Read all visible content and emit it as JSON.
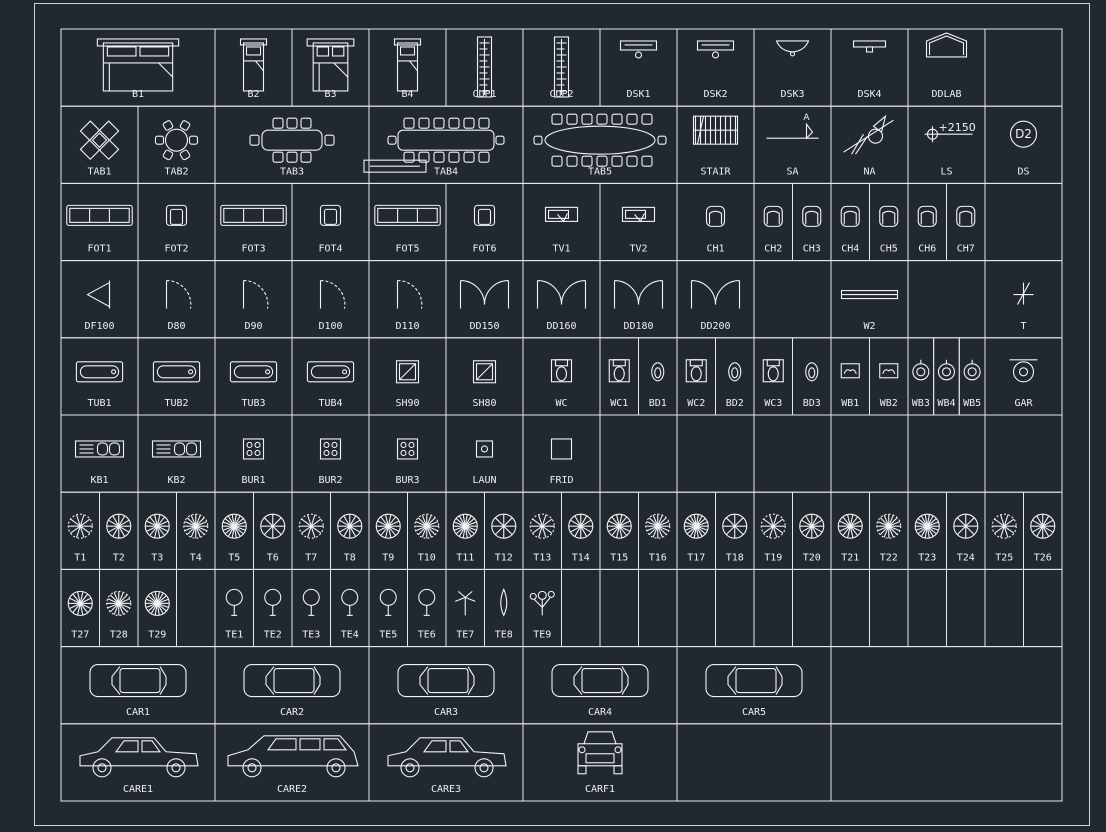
{
  "drawing": {
    "rows": [
      {
        "y": 0,
        "h": 1,
        "cells": [
          {
            "label": "B1",
            "icon": "bed-double-icon",
            "c": 0,
            "w": 2
          },
          {
            "label": "B2",
            "icon": "bed-single-icon",
            "c": 2,
            "w": 1
          },
          {
            "label": "B3",
            "icon": "bed-double-icon",
            "c": 3,
            "w": 1
          },
          {
            "label": "B4",
            "icon": "bed-single-icon",
            "c": 4,
            "w": 1
          },
          {
            "label": "CUP1",
            "icon": "cupboard-icon",
            "c": 5,
            "w": 1
          },
          {
            "label": "CUP2",
            "icon": "cupboard-icon",
            "c": 6,
            "w": 1
          },
          {
            "label": "DSK1",
            "icon": "desk-icon",
            "c": 7,
            "w": 1
          },
          {
            "label": "DSK2",
            "icon": "desk-icon",
            "c": 8,
            "w": 1
          },
          {
            "label": "DSK3",
            "icon": "desk-round-icon",
            "c": 9,
            "w": 1
          },
          {
            "label": "DSK4",
            "icon": "desk-small-icon",
            "c": 10,
            "w": 1
          },
          {
            "label": "DDLAB",
            "icon": "house-icon",
            "c": 11,
            "w": 1
          },
          {
            "label": "",
            "icon": "",
            "c": 12,
            "w": 1
          }
        ]
      },
      {
        "y": 1,
        "h": 1,
        "cells": [
          {
            "label": "TAB1",
            "icon": "table-diagonal-icon",
            "c": 0,
            "w": 1
          },
          {
            "label": "TAB2",
            "icon": "table-round-icon",
            "c": 1,
            "w": 1
          },
          {
            "label": "TAB3",
            "icon": "table-6-icon",
            "c": 2,
            "w": 2
          },
          {
            "label": "TAB4",
            "icon": "table-12-icon",
            "c": 4,
            "w": 2
          },
          {
            "label": "TAB5",
            "icon": "table-oval-icon",
            "c": 6,
            "w": 2
          },
          {
            "label": "STAIR",
            "icon": "stair-icon",
            "c": 8,
            "w": 1
          },
          {
            "label": "SA",
            "icon": "section-arrow-icon",
            "c": 9,
            "w": 1
          },
          {
            "label": "NA",
            "icon": "north-arrow-icon",
            "c": 10,
            "w": 1
          },
          {
            "label": "LS",
            "icon": "level-symbol-icon",
            "c": 11,
            "w": 1
          },
          {
            "label": "DS",
            "icon": "door-symbol-icon",
            "c": 12,
            "w": 1
          }
        ]
      },
      {
        "y": 2,
        "h": 1,
        "cells": [
          {
            "label": "FOT1",
            "icon": "sofa-icon",
            "c": 0,
            "w": 1
          },
          {
            "label": "FOT2",
            "icon": "armchair-icon",
            "c": 1,
            "w": 1
          },
          {
            "label": "FOT3",
            "icon": "sofa-icon",
            "c": 2,
            "w": 1
          },
          {
            "label": "FOT4",
            "icon": "armchair-icon",
            "c": 3,
            "w": 1
          },
          {
            "label": "FOT5",
            "icon": "sofa-icon",
            "c": 4,
            "w": 1
          },
          {
            "label": "FOT6",
            "icon": "armchair-icon",
            "c": 5,
            "w": 1
          },
          {
            "label": "TV1",
            "icon": "tv-icon",
            "c": 6,
            "w": 1
          },
          {
            "label": "TV2",
            "icon": "tv-icon",
            "c": 7,
            "w": 1
          },
          {
            "label": "CH1",
            "icon": "chair-icon",
            "c": 8,
            "w": 1
          },
          {
            "label": "CH2",
            "icon": "chair-icon",
            "c": 9,
            "w": 0.5
          },
          {
            "label": "CH3",
            "icon": "chair-icon",
            "c": 9.5,
            "w": 0.5
          },
          {
            "label": "CH4",
            "icon": "chair-icon",
            "c": 10,
            "w": 0.5
          },
          {
            "label": "CH5",
            "icon": "chair-icon",
            "c": 10.5,
            "w": 0.5
          },
          {
            "label": "CH6",
            "icon": "chair-icon",
            "c": 11,
            "w": 0.5
          },
          {
            "label": "CH7",
            "icon": "chair-icon",
            "c": 11.5,
            "w": 0.5
          },
          {
            "label": "",
            "icon": "",
            "c": 12,
            "w": 1
          }
        ]
      },
      {
        "y": 3,
        "h": 1,
        "cells": [
          {
            "label": "DF100",
            "icon": "door-fold-icon",
            "c": 0,
            "w": 1
          },
          {
            "label": "D80",
            "icon": "door-swing-icon",
            "c": 1,
            "w": 1
          },
          {
            "label": "D90",
            "icon": "door-swing-icon",
            "c": 2,
            "w": 1
          },
          {
            "label": "D100",
            "icon": "door-swing-icon",
            "c": 3,
            "w": 1
          },
          {
            "label": "D110",
            "icon": "door-swing-icon",
            "c": 4,
            "w": 1
          },
          {
            "label": "DD150",
            "icon": "door-double-icon",
            "c": 5,
            "w": 1
          },
          {
            "label": "DD160",
            "icon": "door-double-icon",
            "c": 6,
            "w": 1
          },
          {
            "label": "DD180",
            "icon": "door-double-icon",
            "c": 7,
            "w": 1
          },
          {
            "label": "DD200",
            "icon": "door-double-icon",
            "c": 8,
            "w": 1
          },
          {
            "label": "",
            "icon": "",
            "c": 9,
            "w": 1
          },
          {
            "label": "W2",
            "icon": "window-icon",
            "c": 10,
            "w": 1
          },
          {
            "label": "",
            "icon": "",
            "c": 11,
            "w": 1
          },
          {
            "label": "T",
            "icon": "tag-t-icon",
            "c": 12,
            "w": 1
          }
        ]
      },
      {
        "y": 4,
        "h": 1,
        "cells": [
          {
            "label": "TUB1",
            "icon": "bathtub-icon",
            "c": 0,
            "w": 1
          },
          {
            "label": "TUB2",
            "icon": "bathtub-icon",
            "c": 1,
            "w": 1
          },
          {
            "label": "TUB3",
            "icon": "bathtub-icon",
            "c": 2,
            "w": 1
          },
          {
            "label": "TUB4",
            "icon": "bathtub-icon",
            "c": 3,
            "w": 1
          },
          {
            "label": "SH90",
            "icon": "shower-icon",
            "c": 4,
            "w": 1
          },
          {
            "label": "SH80",
            "icon": "shower-icon",
            "c": 5,
            "w": 1
          },
          {
            "label": "WC",
            "icon": "wc-icon",
            "c": 6,
            "w": 1
          },
          {
            "label": "WC1",
            "icon": "wc-icon",
            "c": 7,
            "w": 0.5
          },
          {
            "label": "BD1",
            "icon": "bidet-icon",
            "c": 7.5,
            "w": 0.5
          },
          {
            "label": "WC2",
            "icon": "wc-icon",
            "c": 8,
            "w": 0.5
          },
          {
            "label": "BD2",
            "icon": "bidet-icon",
            "c": 8.5,
            "w": 0.5
          },
          {
            "label": "WC3",
            "icon": "wc-icon",
            "c": 9,
            "w": 0.5
          },
          {
            "label": "BD3",
            "icon": "bidet-icon",
            "c": 9.5,
            "w": 0.5
          },
          {
            "label": "WB1",
            "icon": "washbasin-icon",
            "c": 10,
            "w": 0.5
          },
          {
            "label": "WB2",
            "icon": "washbasin-icon",
            "c": 10.5,
            "w": 0.5
          },
          {
            "label": "WB3",
            "icon": "washbasin-round-icon",
            "c": 11,
            "w": 0.333
          },
          {
            "label": "WB4",
            "icon": "washbasin-round-icon",
            "c": 11.333,
            "w": 0.333
          },
          {
            "label": "WB5",
            "icon": "washbasin-round-icon",
            "c": 11.666,
            "w": 0.334
          },
          {
            "label": "GAR",
            "icon": "urinal-icon",
            "c": 12,
            "w": 1
          }
        ]
      },
      {
        "y": 5,
        "h": 1,
        "cells": [
          {
            "label": "KB1",
            "icon": "kitchen-sink-icon",
            "c": 0,
            "w": 1
          },
          {
            "label": "KB2",
            "icon": "kitchen-sink-icon",
            "c": 1,
            "w": 1
          },
          {
            "label": "BUR1",
            "icon": "stove-icon",
            "c": 2,
            "w": 1
          },
          {
            "label": "BUR2",
            "icon": "stove-icon",
            "c": 3,
            "w": 1
          },
          {
            "label": "BUR3",
            "icon": "stove-icon",
            "c": 4,
            "w": 1
          },
          {
            "label": "LAUN",
            "icon": "laundry-icon",
            "c": 5,
            "w": 1
          },
          {
            "label": "FRID",
            "icon": "fridge-icon",
            "c": 6,
            "w": 1
          },
          {
            "label": "",
            "icon": "",
            "c": 7,
            "w": 1
          },
          {
            "label": "",
            "icon": "",
            "c": 8,
            "w": 1
          },
          {
            "label": "",
            "icon": "",
            "c": 9,
            "w": 1
          },
          {
            "label": "",
            "icon": "",
            "c": 10,
            "w": 1
          },
          {
            "label": "",
            "icon": "",
            "c": 11,
            "w": 1
          },
          {
            "label": "",
            "icon": "",
            "c": 12,
            "w": 1
          }
        ]
      },
      {
        "y": 6,
        "h": 1,
        "cells": [
          {
            "label": "T1",
            "icon": "tree-plan-icon",
            "c": 0,
            "w": 0.5
          },
          {
            "label": "T2",
            "icon": "tree-plan-icon",
            "c": 0.5,
            "w": 0.5
          },
          {
            "label": "T3",
            "icon": "tree-plan-icon",
            "c": 1,
            "w": 0.5
          },
          {
            "label": "T4",
            "icon": "tree-plan-icon",
            "c": 1.5,
            "w": 0.5
          },
          {
            "label": "T5",
            "icon": "tree-plan-icon",
            "c": 2,
            "w": 0.5
          },
          {
            "label": "T6",
            "icon": "tree-plan-icon",
            "c": 2.5,
            "w": 0.5
          },
          {
            "label": "T7",
            "icon": "tree-plan-icon",
            "c": 3,
            "w": 0.5
          },
          {
            "label": "T8",
            "icon": "tree-plan-icon",
            "c": 3.5,
            "w": 0.5
          },
          {
            "label": "T9",
            "icon": "tree-plan-icon",
            "c": 4,
            "w": 0.5
          },
          {
            "label": "T10",
            "icon": "tree-plan-icon",
            "c": 4.5,
            "w": 0.5
          },
          {
            "label": "T11",
            "icon": "tree-plan-icon",
            "c": 5,
            "w": 0.5
          },
          {
            "label": "T12",
            "icon": "tree-plan-icon",
            "c": 5.5,
            "w": 0.5
          },
          {
            "label": "T13",
            "icon": "tree-plan-icon",
            "c": 6,
            "w": 0.5
          },
          {
            "label": "T14",
            "icon": "tree-plan-icon",
            "c": 6.5,
            "w": 0.5
          },
          {
            "label": "T15",
            "icon": "tree-plan-icon",
            "c": 7,
            "w": 0.5
          },
          {
            "label": "T16",
            "icon": "tree-plan-icon",
            "c": 7.5,
            "w": 0.5
          },
          {
            "label": "T17",
            "icon": "tree-plan-icon",
            "c": 8,
            "w": 0.5
          },
          {
            "label": "T18",
            "icon": "tree-plan-icon",
            "c": 8.5,
            "w": 0.5
          },
          {
            "label": "T19",
            "icon": "tree-plan-icon",
            "c": 9,
            "w": 0.5
          },
          {
            "label": "T20",
            "icon": "tree-plan-icon",
            "c": 9.5,
            "w": 0.5
          },
          {
            "label": "T21",
            "icon": "tree-plan-icon",
            "c": 10,
            "w": 0.5
          },
          {
            "label": "T22",
            "icon": "tree-plan-icon",
            "c": 10.5,
            "w": 0.5
          },
          {
            "label": "T23",
            "icon": "tree-plan-icon",
            "c": 11,
            "w": 0.5
          },
          {
            "label": "T24",
            "icon": "tree-plan-icon",
            "c": 11.5,
            "w": 0.5
          },
          {
            "label": "T25",
            "icon": "tree-plan-icon",
            "c": 12,
            "w": 0.5
          },
          {
            "label": "T26",
            "icon": "tree-plan-icon",
            "c": 12.5,
            "w": 0.5
          }
        ]
      },
      {
        "y": 7,
        "h": 1,
        "cells": [
          {
            "label": "T27",
            "icon": "tree-plan-icon",
            "c": 0,
            "w": 0.5
          },
          {
            "label": "T28",
            "icon": "tree-plan-icon",
            "c": 0.5,
            "w": 0.5
          },
          {
            "label": "T29",
            "icon": "tree-plan-icon",
            "c": 1,
            "w": 0.5
          },
          {
            "label": "",
            "icon": "",
            "c": 1.5,
            "w": 0.5
          },
          {
            "label": "TE1",
            "icon": "tree-elevation-icon",
            "c": 2,
            "w": 0.5
          },
          {
            "label": "TE2",
            "icon": "tree-elevation-icon",
            "c": 2.5,
            "w": 0.5
          },
          {
            "label": "TE3",
            "icon": "tree-elevation-icon",
            "c": 3,
            "w": 0.5
          },
          {
            "label": "TE4",
            "icon": "tree-elevation-icon",
            "c": 3.5,
            "w": 0.5
          },
          {
            "label": "TE5",
            "icon": "tree-elevation-icon",
            "c": 4,
            "w": 0.5
          },
          {
            "label": "TE6",
            "icon": "tree-elevation-icon",
            "c": 4.5,
            "w": 0.5
          },
          {
            "label": "TE7",
            "icon": "palm-elevation-icon",
            "c": 5,
            "w": 0.5
          },
          {
            "label": "TE8",
            "icon": "cypress-elevation-icon",
            "c": 5.5,
            "w": 0.5
          },
          {
            "label": "TE9",
            "icon": "flower-elevation-icon",
            "c": 6,
            "w": 0.5
          },
          {
            "label": "",
            "icon": "",
            "c": 6.5,
            "w": 0.5
          },
          {
            "label": "",
            "icon": "",
            "c": 7,
            "w": 0.5
          },
          {
            "label": "",
            "icon": "",
            "c": 7.5,
            "w": 0.5
          },
          {
            "label": "",
            "icon": "",
            "c": 8,
            "w": 0.5
          },
          {
            "label": "",
            "icon": "",
            "c": 8.5,
            "w": 0.5
          },
          {
            "label": "",
            "icon": "",
            "c": 9,
            "w": 0.5
          },
          {
            "label": "",
            "icon": "",
            "c": 9.5,
            "w": 0.5
          },
          {
            "label": "",
            "icon": "",
            "c": 10,
            "w": 0.5
          },
          {
            "label": "",
            "icon": "",
            "c": 10.5,
            "w": 0.5
          },
          {
            "label": "",
            "icon": "",
            "c": 11,
            "w": 0.5
          },
          {
            "label": "",
            "icon": "",
            "c": 11.5,
            "w": 0.5
          },
          {
            "label": "",
            "icon": "",
            "c": 12,
            "w": 0.5
          },
          {
            "label": "",
            "icon": "",
            "c": 12.5,
            "w": 0.5
          }
        ]
      },
      {
        "y": 8,
        "h": 1,
        "cells": [
          {
            "label": "CAR1",
            "icon": "car-plan-icon",
            "c": 0,
            "w": 2
          },
          {
            "label": "CAR2",
            "icon": "car-plan-icon",
            "c": 2,
            "w": 2
          },
          {
            "label": "CAR3",
            "icon": "car-plan-icon",
            "c": 4,
            "w": 2
          },
          {
            "label": "CAR4",
            "icon": "car-plan-icon",
            "c": 6,
            "w": 2
          },
          {
            "label": "CAR5",
            "icon": "car-plan-icon",
            "c": 8,
            "w": 2
          },
          {
            "label": "",
            "icon": "",
            "c": 10,
            "w": 3
          }
        ]
      },
      {
        "y": 9,
        "h": 1,
        "cells": [
          {
            "label": "CARE1",
            "icon": "car-side-icon",
            "c": 0,
            "w": 2
          },
          {
            "label": "CARE2",
            "icon": "car-wagon-icon",
            "c": 2,
            "w": 2
          },
          {
            "label": "CARE3",
            "icon": "car-side-icon",
            "c": 4,
            "w": 2
          },
          {
            "label": "CARF1",
            "icon": "car-front-icon",
            "c": 6,
            "w": 2
          },
          {
            "label": "",
            "icon": "",
            "c": 8,
            "w": 2
          },
          {
            "label": "",
            "icon": "",
            "c": 10,
            "w": 3
          }
        ]
      }
    ],
    "symbol_text": {
      "sa": "A",
      "ls": "+2150",
      "ds": "D2"
    },
    "colors": {
      "background": "#212830",
      "line": "#e6e8ea"
    }
  }
}
